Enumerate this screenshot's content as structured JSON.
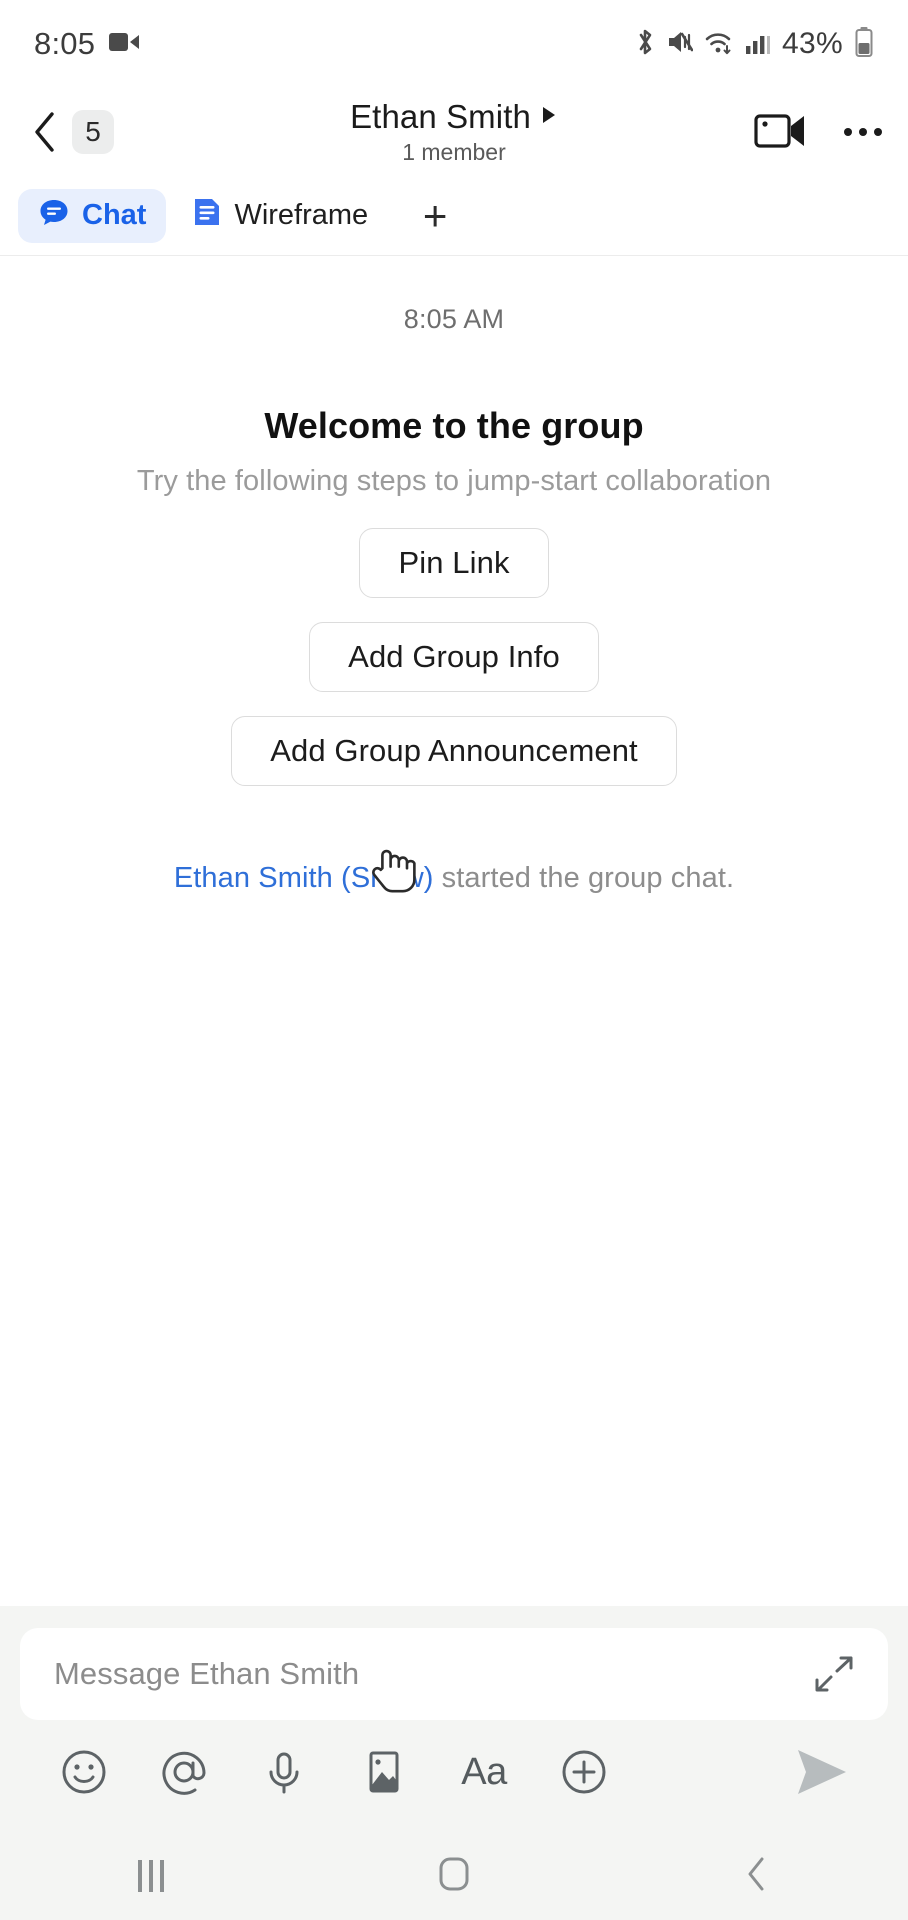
{
  "status_bar": {
    "time": "8:05",
    "battery_percent": "43%",
    "icons": [
      "video-recording-icon",
      "bluetooth-icon",
      "mute-icon",
      "wifi-icon",
      "cellular-signal-icon",
      "battery-icon"
    ]
  },
  "header": {
    "back_label": "back-chevron",
    "unread_count": "5",
    "title": "Ethan Smith",
    "title_caret": "▶",
    "subtitle": "1 member",
    "video_call_label": "video-call",
    "overflow_label": "more-options"
  },
  "tabs": {
    "items": [
      {
        "label": "Chat",
        "icon": "chat-bubble-icon",
        "active": true
      },
      {
        "label": "Wireframe",
        "icon": "document-icon",
        "active": false
      }
    ],
    "add_label": "+"
  },
  "conversation": {
    "daystamp": "8:05 AM",
    "welcome_title": "Welcome to the group",
    "welcome_subtitle": "Try the following steps to jump-start collaboration",
    "actions": [
      {
        "label": "Pin Link"
      },
      {
        "label": "Add Group Info"
      },
      {
        "label": "Add Group Announcement"
      }
    ],
    "system_message": {
      "actor": "Ethan Smith (Snow)",
      "text": " started the group chat."
    }
  },
  "composer": {
    "placeholder": "Message Ethan Smith",
    "expand_label": "expand-compose",
    "tools": [
      {
        "name": "emoji-icon"
      },
      {
        "name": "mention-icon"
      },
      {
        "name": "microphone-icon"
      },
      {
        "name": "image-icon"
      },
      {
        "name": "text-format-icon",
        "label": "Aa"
      },
      {
        "name": "plus-icon"
      }
    ],
    "send_label": "send"
  },
  "navbar": {
    "recents_label": "recent-apps",
    "home_label": "home",
    "back_label": "back"
  },
  "colors": {
    "accent": "#1a62e8",
    "tab_active_bg": "#e8effd",
    "link": "#2f6fd8",
    "panel_bg": "#f4f5f3",
    "muted_text": "#8d8d8d"
  }
}
